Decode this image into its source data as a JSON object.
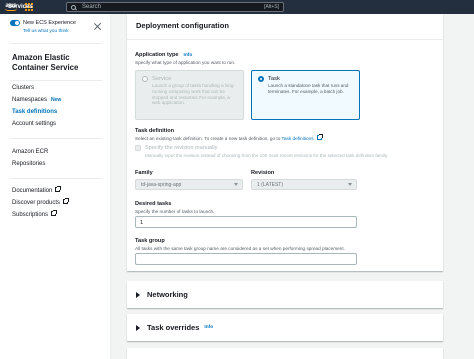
{
  "topbar": {
    "logo_text": "aws",
    "services_label": "Services",
    "search_placeholder": "Search",
    "search_shortcut": "[Alt+S]"
  },
  "sidebar": {
    "toggle_label": "New ECS Experience",
    "feedback_link": "Tell us what you think",
    "title": "Amazon Elastic Container Service",
    "nav": {
      "clusters": "Clusters",
      "namespaces": "Namespaces",
      "new_badge": "New",
      "task_definitions": "Task definitions",
      "account_settings": "Account settings",
      "ecr": "Amazon ECR",
      "repositories": "Repositories",
      "documentation": "Documentation",
      "discover_products": "Discover products",
      "subscriptions": "Subscriptions"
    }
  },
  "deployment": {
    "header": "Deployment configuration",
    "app_type_label": "Application type",
    "info": "Info",
    "app_type_desc": "Specify what type of application you want to run.",
    "service_title": "Service",
    "service_desc": "Launch a group of tasks handling a long-running computing work that can be stopped and restarted. For example, a web application.",
    "task_title": "Task",
    "task_desc": "Launch a standalone task that runs and terminates. For example, a batch job.",
    "task_def_label": "Task definition",
    "task_def_desc": "Select an existing task definition. To create a new task definition, go to",
    "task_def_link": "Task definitions",
    "revision_manual_label": "Specify the revision manually",
    "revision_manual_desc": "Manually input the revision instead of choosing from the 100 most recent revisions for the selected task definition family.",
    "family_label": "Family",
    "family_value": "td-java-spring-app",
    "revision_label": "Revision",
    "revision_value": "1 (LATEST)",
    "desired_label": "Desired tasks",
    "desired_desc": "Specify the number of tasks to launch.",
    "desired_value": "1",
    "group_label": "Task group",
    "group_desc": "All tasks with the same task group name are considered as a set when performing spread placement.",
    "group_value": ""
  },
  "networking": {
    "title": "Networking"
  },
  "overrides": {
    "title": "Task overrides",
    "info": "Info"
  }
}
